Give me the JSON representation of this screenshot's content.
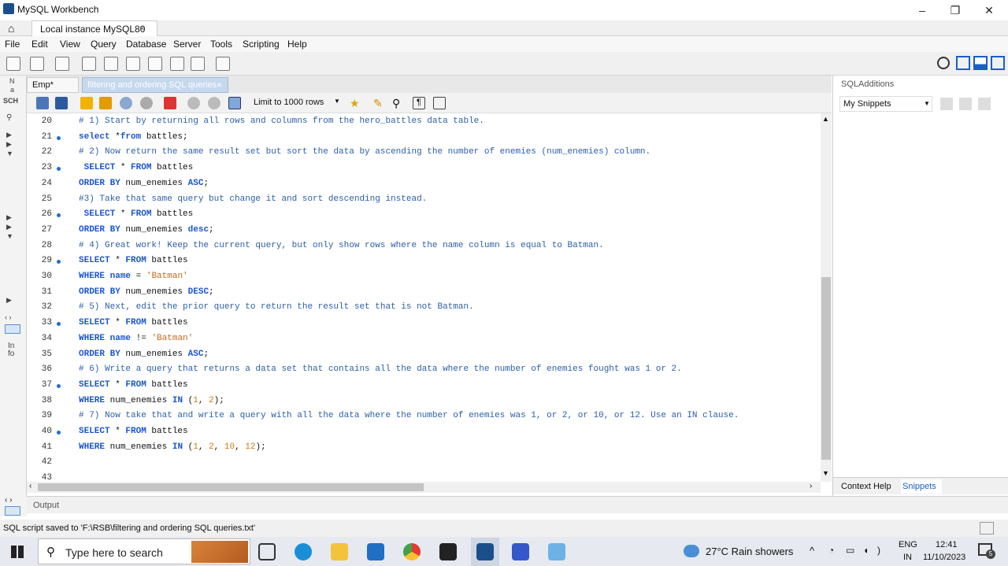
{
  "window": {
    "title": "MySQL Workbench",
    "minimize": "–",
    "restore": "❐",
    "close": "✕"
  },
  "connection_tab": {
    "home_icon": "home-icon",
    "label": "Local instance MySQL80",
    "close": "×"
  },
  "menu": [
    "File",
    "Edit",
    "View",
    "Query",
    "Database",
    "Server",
    "Tools",
    "Scripting",
    "Help"
  ],
  "left_strip": {
    "top_label": "N",
    "second": "a",
    "sch": "SCH",
    "in_label": "In",
    "fo_label": "fo"
  },
  "query_tabs": [
    {
      "label": "Emp*"
    },
    {
      "label": "filtering and ordering SQL queries",
      "close": "×"
    }
  ],
  "editor_toolbar": {
    "limit_label": "Limit to 1000 rows"
  },
  "code_lines": [
    {
      "n": "20",
      "dot": false,
      "html": "<span class='cm'># 1) Start by returning all rows and columns from the hero_battles data table.</span>"
    },
    {
      "n": "21",
      "dot": true,
      "html": "<span class='kw'>select</span> *<span class='kw'>from</span> battles;"
    },
    {
      "n": "22",
      "dot": false,
      "html": "<span class='cm'># 2) Now return the same result set but sort the data by ascending the number of enemies (num_enemies) column.</span>"
    },
    {
      "n": "23",
      "dot": true,
      "html": " <span class='kw'>SELECT</span> * <span class='kw'>FROM</span> battles"
    },
    {
      "n": "24",
      "dot": false,
      "html": "<span class='kw'>ORDER BY</span> num_enemies <span class='kw'>ASC</span>;"
    },
    {
      "n": "25",
      "dot": false,
      "html": "<span class='cm'>#3) Take that same query but change it and sort descending instead.</span>"
    },
    {
      "n": "26",
      "dot": true,
      "html": " <span class='kw'>SELECT</span> * <span class='kw'>FROM</span> battles"
    },
    {
      "n": "27",
      "dot": false,
      "html": "<span class='kw'>ORDER BY</span> num_enemies <span class='kw'>desc</span>;"
    },
    {
      "n": "28",
      "dot": false,
      "html": "<span class='cm'># 4) Great work! Keep the current query, but only show rows where the name column is equal to Batman.</span>"
    },
    {
      "n": "29",
      "dot": true,
      "html": "<span class='kw'>SELECT</span> * <span class='kw'>FROM</span> battles"
    },
    {
      "n": "30",
      "dot": false,
      "html": "<span class='kw'>WHERE</span> <span class='kw'>name</span> = <span class='st'>'Batman'</span>"
    },
    {
      "n": "31",
      "dot": false,
      "html": "<span class='kw'>ORDER BY</span> num_enemies <span class='kw'>DESC</span>;"
    },
    {
      "n": "32",
      "dot": false,
      "html": "<span class='cm'># 5) Next, edit the prior query to return the result set that is not Batman.</span>"
    },
    {
      "n": "33",
      "dot": true,
      "html": "<span class='kw'>SELECT</span> * <span class='kw'>FROM</span> battles"
    },
    {
      "n": "34",
      "dot": false,
      "html": "<span class='kw'>WHERE</span> <span class='kw'>name</span> != <span class='st'>'Batman'</span>"
    },
    {
      "n": "35",
      "dot": false,
      "html": "<span class='kw'>ORDER BY</span> num_enemies <span class='kw'>ASC</span>;"
    },
    {
      "n": "36",
      "dot": false,
      "html": "<span class='cm'># 6) Write a query that returns a data set that contains all the data where the number of enemies fought was 1 or 2.</span>"
    },
    {
      "n": "37",
      "dot": true,
      "html": "<span class='kw'>SELECT</span> * <span class='kw'>FROM</span> battles"
    },
    {
      "n": "38",
      "dot": false,
      "html": "<span class='kw'>WHERE</span> num_enemies <span class='kw'>IN</span> (<span class='nm'>1</span>, <span class='nm'>2</span>);"
    },
    {
      "n": "39",
      "dot": false,
      "html": "<span class='cm'># 7) Now take that and write a query with all the data where the number of enemies was 1, or 2, or 10, or 12. Use an IN clause.</span>"
    },
    {
      "n": "40",
      "dot": true,
      "html": "<span class='kw'>SELECT</span> * <span class='kw'>FROM</span> battles"
    },
    {
      "n": "41",
      "dot": false,
      "html": "<span class='kw'>WHERE</span> num_enemies <span class='kw'>IN</span> (<span class='nm'>1</span>, <span class='nm'>2</span>, <span class='nm'>10</span>, <span class='nm'>12</span>);"
    },
    {
      "n": "42",
      "dot": false,
      "html": ""
    },
    {
      "n": "43",
      "dot": false,
      "html": ""
    }
  ],
  "right_panel": {
    "title": "SQLAdditions",
    "dropdown": "My Snippets",
    "tab_context": "Context Help",
    "tab_snippets": "Snippets"
  },
  "output": {
    "label": "Output"
  },
  "status": {
    "text": "SQL script saved to 'F:\\RSB\\filtering and ordering SQL queries.txt'"
  },
  "taskbar": {
    "search_placeholder": "Type here to search",
    "weather": "27°C  Rain showers",
    "lang1": "ENG",
    "lang2": "IN",
    "time": "12:41",
    "date": "11/10/2023",
    "notif_count": "5"
  }
}
